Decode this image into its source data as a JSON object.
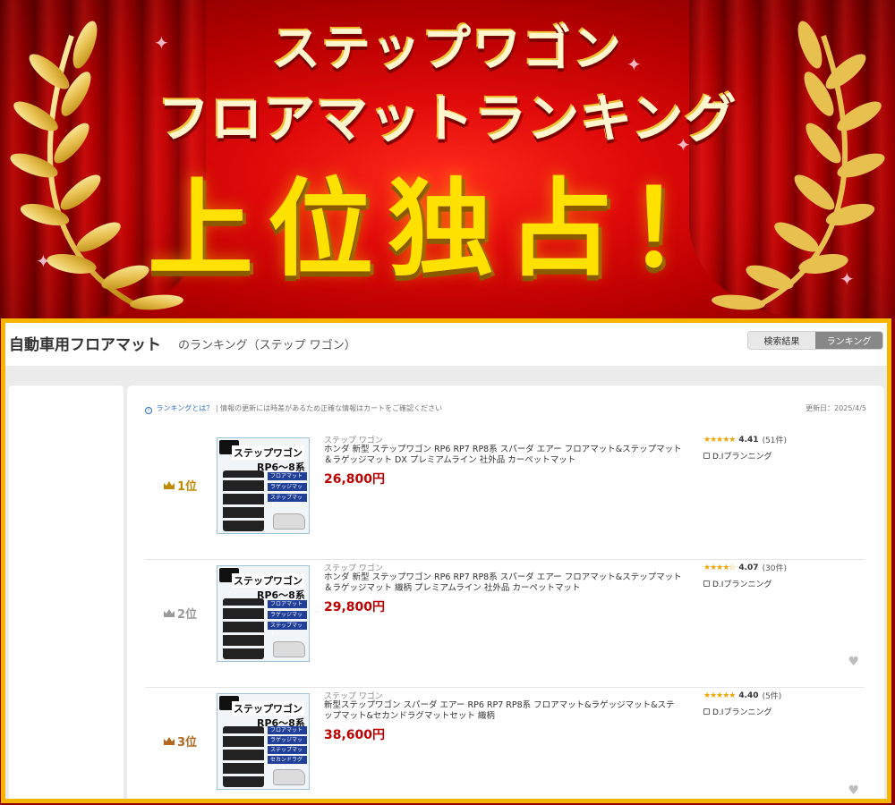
{
  "banner": {
    "line1": "ステップワゴン",
    "line2": "フロアマットランキング",
    "line3": "上位独占！"
  },
  "panel": {
    "title": "自動車用フロアマット",
    "subtitle": "のランキング（ステップ ワゴン）",
    "toggle": {
      "search": "検索結果",
      "ranking": "ランキング"
    },
    "info_link": "ランキングとは？",
    "info_text": "| 情報の更新には時差があるため正確な情報はカートをご確認ください",
    "updated": "更新日：2025/4/5"
  },
  "items": [
    {
      "rank": "1位",
      "rank_color": "#c08a00",
      "category": "ステップ ワゴン",
      "title": "ホンダ 新型 ステップワゴン RP6 RP7 RP8系 スパーダ エアー フロアマット&ステップマット＆ラゲッジマット DX プレミアムライン 社外品 カーペットマット",
      "price": "26,800円",
      "stars": "★★★★★",
      "rating": "4.41",
      "reviews": "(51件)",
      "shop": "D.Iプランニング",
      "thumb_title": "ステップワゴン",
      "thumb_sub": "RP6〜8系",
      "thumb_tags": [
        "フロアマット",
        "ラゲッジマット",
        "ステップマット"
      ]
    },
    {
      "rank": "2位",
      "rank_color": "#9a9a9a",
      "category": "ステップ ワゴン",
      "title": "ホンダ 新型 ステップワゴン RP6 RP7 RP8系 スパーダ エアー フロアマット&ステップマット＆ラゲッジマット 織柄 プレミアムライン 社外品 カーペットマット",
      "price": "29,800円",
      "stars": "★★★★☆",
      "rating": "4.07",
      "reviews": "(30件)",
      "shop": "D.Iプランニング",
      "thumb_title": "ステップワゴン",
      "thumb_sub": "RP6〜8系",
      "thumb_tags": [
        "フロアマット",
        "ラゲッジマット",
        "ステップマット"
      ]
    },
    {
      "rank": "3位",
      "rank_color": "#b4671e",
      "category": "ステップ ワゴン",
      "title": "新型ステップワゴン スパーダ エアー RP6 RP7 RP8系 フロアマット&ラゲッジマット&ステップマット&セカンドラグマットセット 織柄",
      "price": "38,600円",
      "stars": "★★★★★",
      "rating": "4.40",
      "reviews": "(5件)",
      "shop": "D.Iプランニング",
      "thumb_title": "ステップワゴン",
      "thumb_sub": "RP6〜8系",
      "thumb_tags": [
        "フロアマット",
        "ラゲッジマット",
        "ステップマット",
        "セカンドラグマット"
      ]
    }
  ]
}
